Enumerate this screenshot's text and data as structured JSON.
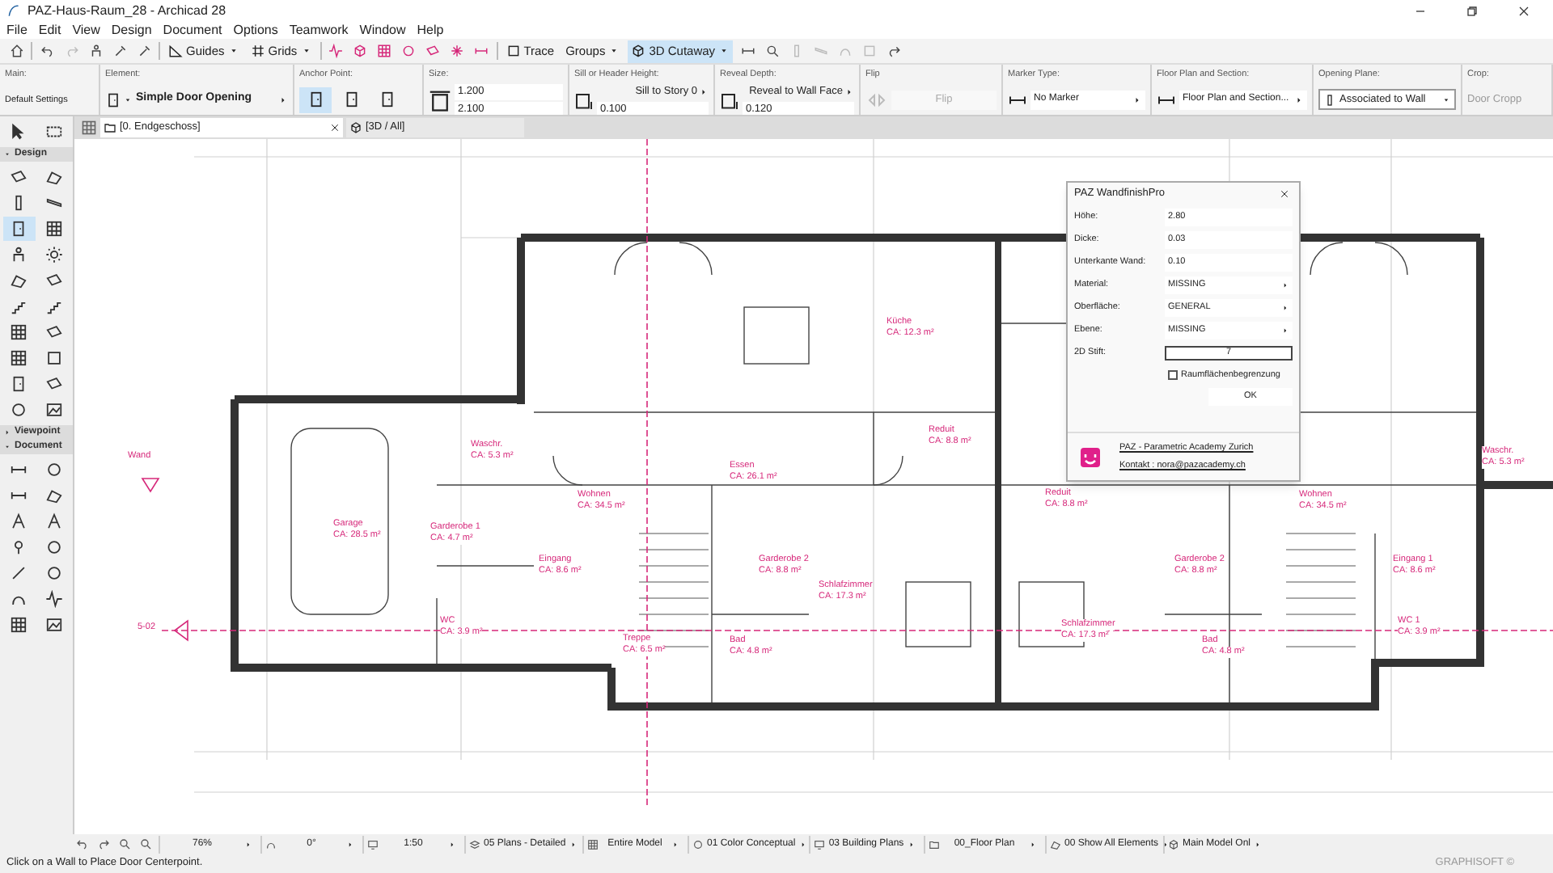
{
  "window": {
    "title": "PAZ-Haus-Raum_28 - Archicad 28"
  },
  "menu": [
    "File",
    "Edit",
    "View",
    "Design",
    "Document",
    "Options",
    "Teamwork",
    "Window",
    "Help"
  ],
  "toolbar": [
    {
      "kind": "menu",
      "label": "Guides",
      "selected": false
    },
    {
      "kind": "menu",
      "label": "Grids",
      "selected": false
    },
    {
      "kind": "toggle",
      "label": "Trace",
      "selected": false
    },
    {
      "kind": "menu",
      "label": "Groups",
      "selected": false
    },
    {
      "kind": "menu",
      "label": "3D Cutaway",
      "selected": true
    }
  ],
  "info_box": [
    {
      "kind": "settings",
      "label": "Main:",
      "value": "Default Settings"
    },
    {
      "kind": "element",
      "label": "Element:",
      "value": "Simple Door Opening"
    },
    {
      "kind": "anchor",
      "label": "Anchor Point:",
      "options": [
        {
          "selected": true
        },
        {
          "selected": false
        },
        {
          "selected": false
        }
      ]
    },
    {
      "kind": "size",
      "label": "Size:",
      "values": [
        "1.200",
        "2.100"
      ]
    },
    {
      "kind": "height",
      "label": "Sill or Header Height:",
      "mode": "Sill to Story 0",
      "value": "0.100"
    },
    {
      "kind": "height",
      "label": "Reveal Depth:",
      "mode": "Reveal to Wall Face",
      "value": "0.120"
    },
    {
      "kind": "button",
      "label": "Flip",
      "value": "Flip",
      "disabled": true
    },
    {
      "kind": "dropdown",
      "label": "Marker Type:",
      "value": "No Marker"
    },
    {
      "kind": "dropdown",
      "label": "Floor Plan and Section:",
      "value": "Floor Plan and Section..."
    },
    {
      "kind": "select",
      "label": "Opening Plane:",
      "value": "Associated to Wall"
    },
    {
      "kind": "text",
      "label": "Crop:",
      "value": "Door Cropp"
    }
  ],
  "tabs": [
    {
      "label": "[0. Endgeschoss]",
      "selected": true
    },
    {
      "label": "[3D / All]",
      "selected": false
    }
  ],
  "toolbox": {
    "top": [
      {
        "selected": false
      },
      {
        "selected": false
      }
    ],
    "sections": [
      {
        "label": "Design",
        "expanded": true,
        "tools": [
          {
            "selected": false
          },
          {
            "selected": false
          },
          {
            "selected": false
          },
          {
            "selected": false
          },
          {
            "selected": true
          },
          {
            "selected": false
          },
          {
            "selected": false
          },
          {
            "selected": false
          },
          {
            "selected": false
          },
          {
            "selected": false
          },
          {
            "selected": false
          },
          {
            "selected": false
          },
          {
            "selected": false
          },
          {
            "selected": false
          },
          {
            "selected": false
          },
          {
            "selected": false
          },
          {
            "selected": false
          },
          {
            "selected": false
          },
          {
            "selected": false
          },
          {
            "selected": false
          }
        ]
      },
      {
        "label": "Viewpoint",
        "expanded": false
      },
      {
        "label": "Document",
        "expanded": true,
        "tools": [
          {
            "selected": false
          },
          {
            "selected": false
          },
          {
            "selected": false
          },
          {
            "selected": false
          },
          {
            "selected": false
          },
          {
            "selected": false
          },
          {
            "selected": false
          },
          {
            "selected": false
          },
          {
            "selected": false
          },
          {
            "selected": false
          },
          {
            "selected": false
          },
          {
            "selected": false
          },
          {
            "selected": false
          },
          {
            "selected": false
          }
        ]
      }
    ]
  },
  "rooms": [
    {
      "name": "Waschr.",
      "area": "CA: 5.3 m²"
    },
    {
      "name": "Garage",
      "area": "CA: 28.5 m²"
    },
    {
      "name": "Wohnen",
      "area": "CA: 34.5 m²"
    },
    {
      "name": "Essen",
      "area": "CA: 26.1 m²"
    },
    {
      "name": "Küche",
      "area": "CA: 12.3 m²"
    },
    {
      "name": "Reduit",
      "area": "CA: 8.8 m²"
    },
    {
      "name": "Garderobe 1",
      "area": "CA: 4.7 m²"
    },
    {
      "name": "Eingang",
      "area": "CA: 8.6 m²"
    },
    {
      "name": "WC",
      "area": "CA: 3.9 m²"
    },
    {
      "name": "Garderobe 2",
      "area": "CA: 8.8 m²"
    },
    {
      "name": "Schlafzimmer",
      "area": "CA: 17.3 m²"
    },
    {
      "name": "Treppe",
      "area": "CA: 6.5 m²"
    },
    {
      "name": "Bad",
      "area": "CA: 4.8 m²"
    },
    {
      "name": "Reduit",
      "area": "CA: 8.8 m²"
    },
    {
      "name": "Wohnen",
      "area": "CA: 34.5 m²"
    },
    {
      "name": "Garderobe 2",
      "area": "CA: 8.8 m²"
    },
    {
      "name": "Schlafzimmer",
      "area": "CA: 17.3 m²"
    },
    {
      "name": "Bad",
      "area": "CA: 4.8 m²"
    },
    {
      "name": "Eingang 1",
      "area": "CA: 8.6 m²"
    },
    {
      "name": "Waschr.",
      "area": "CA: 5.3 m²"
    },
    {
      "name": "WC 1",
      "area": "CA: 3.9 m²"
    }
  ],
  "markers": [
    "Wand",
    "5-02"
  ],
  "dialog": {
    "title": "PAZ WandfinishPro",
    "rows": [
      {
        "kind": "field",
        "label": "Höhe:",
        "value": "2.80"
      },
      {
        "kind": "field",
        "label": "Dicke:",
        "value": "0.03"
      },
      {
        "kind": "field",
        "label": "Unterkante Wand:",
        "value": "0.10"
      },
      {
        "kind": "popup",
        "label": "Material:",
        "value": "MISSING"
      },
      {
        "kind": "popup",
        "label": "Oberfläche:",
        "value": "GENERAL"
      },
      {
        "kind": "popup",
        "label": "Ebene:",
        "value": "MISSING"
      },
      {
        "kind": "pen",
        "label": "2D Stift:",
        "value": "7"
      }
    ],
    "checkbox": {
      "label": "Raumflächenbegrenzung",
      "checked": false
    },
    "button": "OK",
    "links": [
      "PAZ - Parametric Academy Zurich",
      "Kontakt : nora@pazacademy.ch"
    ]
  },
  "nav_bar": [
    "76%",
    "0°",
    "1:50",
    "05 Plans - Detailed",
    "Entire Model",
    "01 Color Conceptual",
    "03 Building Plans",
    "00_Floor Plan",
    "00 Show All Elements",
    "Main Model Onl"
  ],
  "status_bar": {
    "message": "Click on a Wall to Place Door Centerpoint.",
    "brand": "GRAPHISOFT ©"
  }
}
